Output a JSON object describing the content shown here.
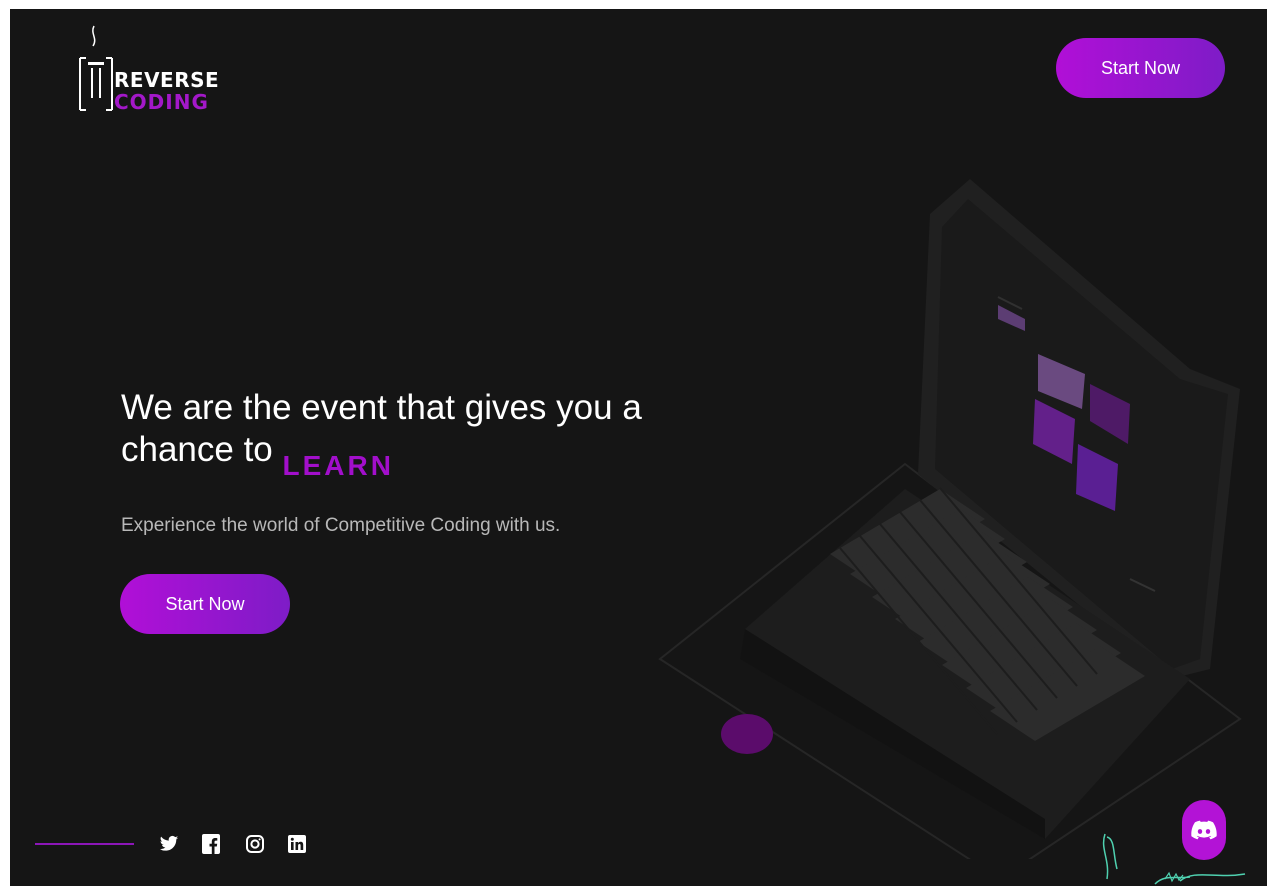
{
  "brand": {
    "word1": "REVERSE",
    "word2": "CODING",
    "accent": "#a318c9"
  },
  "header": {
    "cta_label": "Start Now"
  },
  "hero": {
    "headline": "We are the event that gives you a chance to",
    "rotating_word": "LEARN",
    "subtext": "Experience the world of Competitive Coding with us.",
    "cta_label": "Start Now"
  },
  "social": {
    "icons": [
      "twitter-icon",
      "facebook-icon",
      "instagram-icon",
      "linkedin-icon"
    ]
  },
  "discord": {
    "icon": "discord-icon"
  },
  "colors": {
    "background": "#151515",
    "button_gradient_start": "#b10fd7",
    "button_gradient_end": "#7e1cc7",
    "accent_purple": "#a20fcb"
  }
}
